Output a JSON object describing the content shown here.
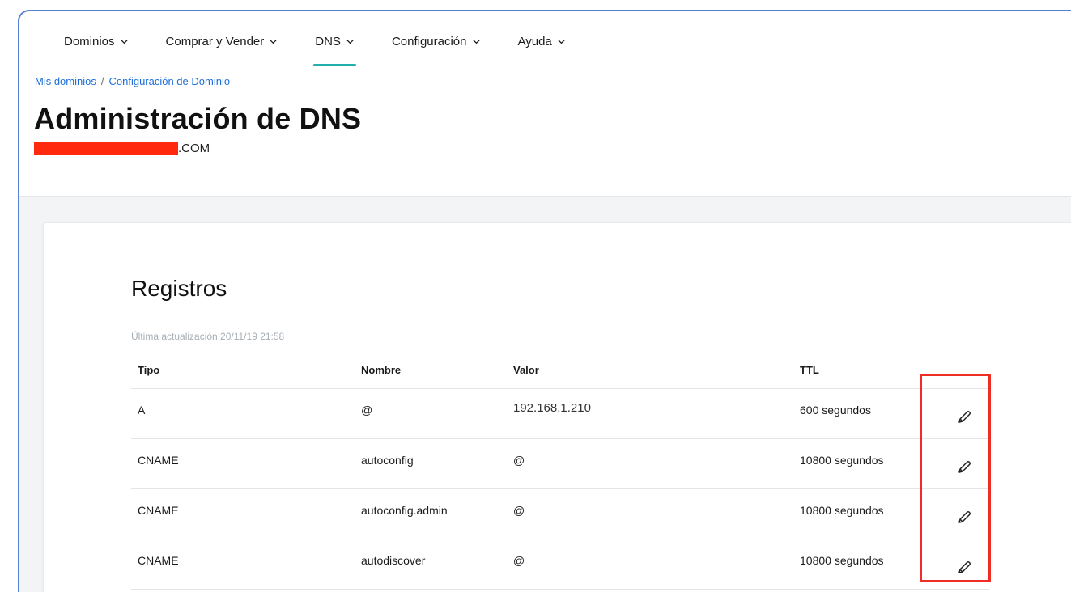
{
  "nav": {
    "items": [
      {
        "label": "Dominios"
      },
      {
        "label": "Comprar y Vender"
      },
      {
        "label": "DNS"
      },
      {
        "label": "Configuración"
      },
      {
        "label": "Ayuda"
      }
    ]
  },
  "breadcrumb": {
    "first": "Mis dominios",
    "separator": "/",
    "second": "Configuración de Dominio"
  },
  "page": {
    "title": "Administración de DNS",
    "domain_suffix": ".COM"
  },
  "records": {
    "title": "Registros",
    "last_update": "Última actualización 20/11/19 21:58",
    "headers": {
      "tipo": "Tipo",
      "nombre": "Nombre",
      "valor": "Valor",
      "ttl": "TTL"
    },
    "rows": [
      {
        "tipo": "A",
        "nombre": "@",
        "valor": "192.168.1.210",
        "ttl": "600 segundos"
      },
      {
        "tipo": "CNAME",
        "nombre": "autoconfig",
        "valor": "@",
        "ttl": "10800 segundos"
      },
      {
        "tipo": "CNAME",
        "nombre": "autoconfig.admin",
        "valor": "@",
        "ttl": "10800 segundos"
      },
      {
        "tipo": "CNAME",
        "nombre": "autodiscover",
        "valor": "@",
        "ttl": "10800 segundos"
      }
    ]
  },
  "icons": {
    "chevron": "chevron-down-icon",
    "edit": "pencil-icon"
  },
  "colors": {
    "link": "#1e6fd9",
    "active_underline": "#22b0ae",
    "highlight": "#ee2d24",
    "redaction": "#ff2a0e",
    "frame": "#5a7fd6"
  }
}
